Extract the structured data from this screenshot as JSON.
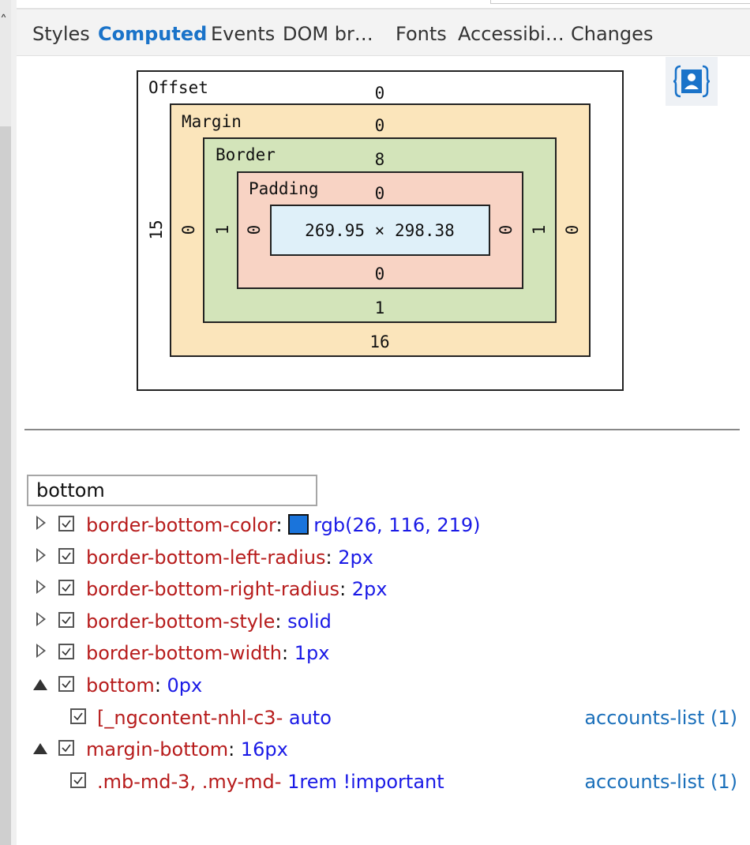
{
  "tabs": [
    {
      "label": "Styles",
      "active": false
    },
    {
      "label": "Computed",
      "active": true
    },
    {
      "label": "Events",
      "active": false
    },
    {
      "label": "DOM br…",
      "active": false
    },
    {
      "label": "Fonts",
      "active": false
    },
    {
      "label": "Accessibi…",
      "active": false
    },
    {
      "label": "Changes",
      "active": false
    }
  ],
  "box_model": {
    "offset": {
      "label": "Offset",
      "top": "0",
      "left": "15"
    },
    "margin": {
      "label": "Margin",
      "top": "0",
      "right": "0",
      "bottom": "16",
      "left": "0"
    },
    "border": {
      "label": "Border",
      "top": "8",
      "right": "1",
      "bottom": "1",
      "left": "1"
    },
    "padding": {
      "label": "Padding",
      "top": "0",
      "right": "0",
      "bottom": "0",
      "left": "0"
    },
    "content": "269.95 × 298.38"
  },
  "filter": {
    "value": "bottom"
  },
  "properties": [
    {
      "name": "border-bottom-color",
      "value": "rgb(26, 116, 219)",
      "swatch": "#1a74db",
      "expanded": false
    },
    {
      "name": "border-bottom-left-radius",
      "value": "2px",
      "expanded": false
    },
    {
      "name": "border-bottom-right-radius",
      "value": "2px",
      "expanded": false
    },
    {
      "name": "border-bottom-style",
      "value": "solid",
      "expanded": false
    },
    {
      "name": "border-bottom-width",
      "value": "1px",
      "expanded": false
    },
    {
      "name": "bottom",
      "value": "0px",
      "expanded": true,
      "rule": {
        "selector": "[_ngcontent-nhl-c3-",
        "value": "auto",
        "source": "accounts-list (1)"
      }
    },
    {
      "name": "margin-bottom",
      "value": "16px",
      "expanded": true,
      "rule": {
        "selector": ".mb-md-3, .my-md-",
        "value": "1rem !important",
        "source": "accounts-list (1)"
      }
    }
  ],
  "colors": {
    "accent": "#1a73c9",
    "property_name": "#b71c1c",
    "property_value": "#1a1ae6",
    "link": "#1a6fba"
  }
}
